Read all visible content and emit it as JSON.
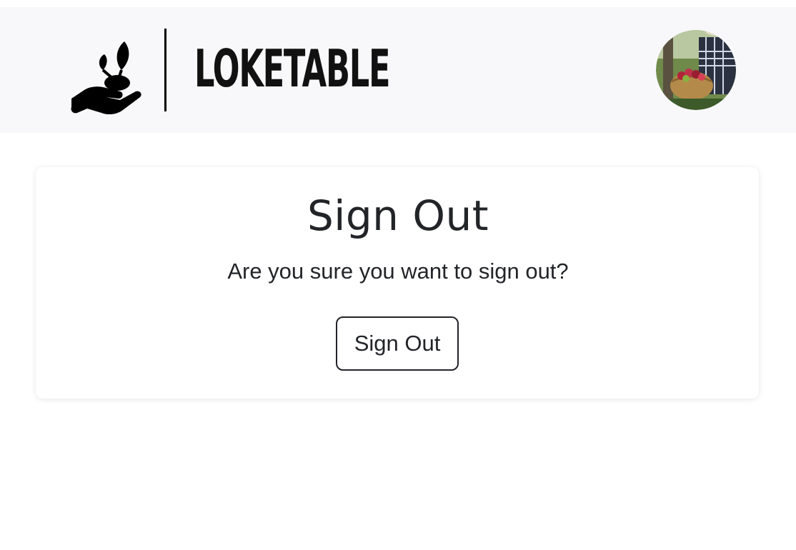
{
  "header": {
    "brand_name": "LOKETABLE",
    "logo_icon": "hand-holding-seedling-icon",
    "avatar_alt": "User avatar"
  },
  "signout": {
    "title": "Sign Out",
    "question": "Are you sure you want to sign out?",
    "button_label": "Sign Out"
  },
  "colors": {
    "header_bg": "#f8f8fb",
    "text": "#222428",
    "card_bg": "#ffffff",
    "logo": "#000000"
  }
}
